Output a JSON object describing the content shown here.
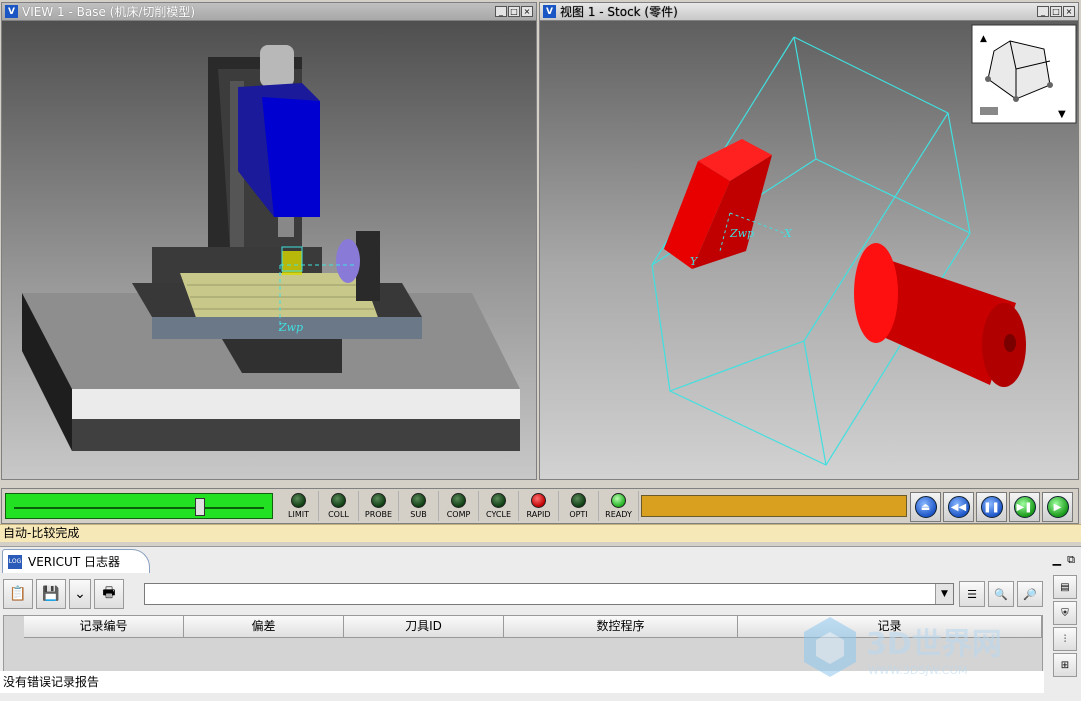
{
  "views": {
    "left": {
      "title": "VIEW 1 - Base (机床/切削模型)",
      "wp_label": "Zwp"
    },
    "right": {
      "title": "视图 1 - Stock (零件)",
      "wp_label": "Zwp",
      "x_label": "X",
      "y_label": "Y"
    }
  },
  "window_buttons": {
    "minimize": "_",
    "restore": "□",
    "close": "×"
  },
  "indicators": [
    {
      "label": "LIMIT",
      "state": "off"
    },
    {
      "label": "COLL",
      "state": "off"
    },
    {
      "label": "PROBE",
      "state": "off"
    },
    {
      "label": "SUB",
      "state": "off"
    },
    {
      "label": "COMP",
      "state": "off"
    },
    {
      "label": "CYCLE",
      "state": "off"
    },
    {
      "label": "RAPID",
      "state": "red"
    },
    {
      "label": "OPTI",
      "state": "off"
    },
    {
      "label": "READY",
      "state": "green"
    }
  ],
  "slider": {
    "position_fraction": 0.74
  },
  "playback": {
    "reset": "⏏",
    "rewind": "◀◀",
    "pause": "❚❚",
    "step": "▶❚",
    "play": "▶"
  },
  "status_text": "自动-比较完成",
  "log": {
    "tab_label": "VERICUT 日志器",
    "tab_icon": "LOG",
    "columns": [
      "记录编号",
      "偏差",
      "刀具ID",
      "数控程序",
      "记录"
    ],
    "empty_message": "没有错误记录报告"
  },
  "watermark": {
    "text": "3D世界网",
    "sub": "WWW.3DSJW.COM"
  },
  "colors": {
    "slider": "#22e022",
    "progress": "#d9a020",
    "status_bg": "#f7e8b8",
    "part": "#e00000",
    "stock_box": "#40e0e0"
  }
}
